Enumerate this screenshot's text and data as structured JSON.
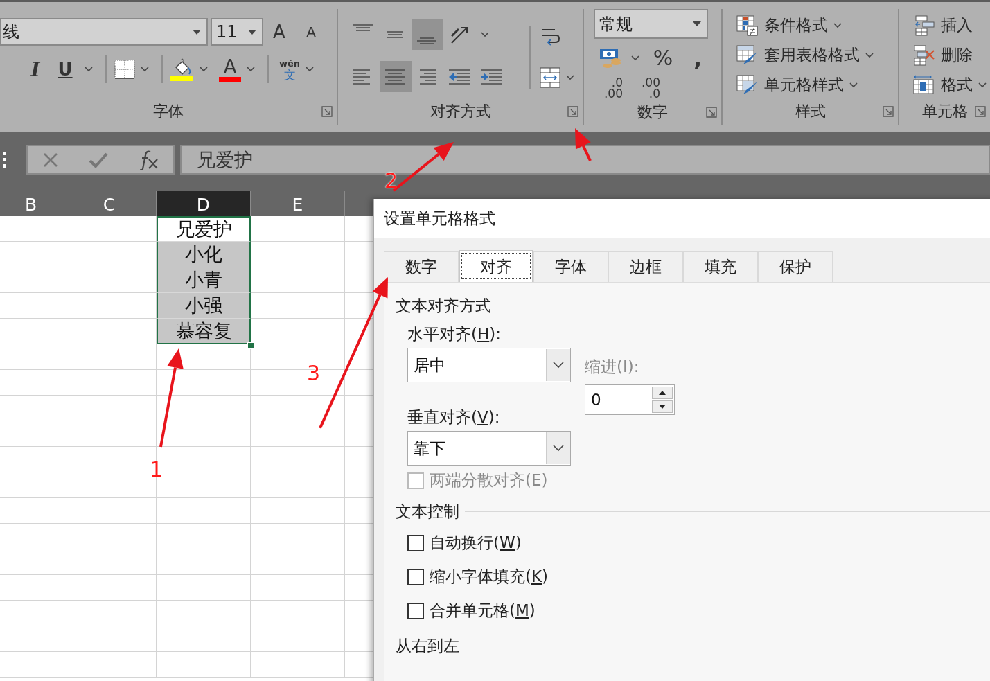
{
  "ribbon": {
    "font": {
      "label": "字体",
      "font_name": "线",
      "font_size": "11",
      "grow_button": "A",
      "shrink_button": "A",
      "italic_button": "I",
      "underline_button": "U",
      "font_color_button": "A",
      "phonetic_button": {
        "top": "wén",
        "bottom": "文"
      }
    },
    "alignment": {
      "label": "对齐方式",
      "buttons": [
        {
          "kind": "top",
          "selected": false
        },
        {
          "kind": "middle",
          "selected": false
        },
        {
          "kind": "bottom",
          "selected": true
        },
        {
          "kind": "orientation",
          "selected": false
        },
        {
          "kind": "left",
          "selected": false
        },
        {
          "kind": "center",
          "selected": true
        },
        {
          "kind": "right",
          "selected": false
        },
        {
          "kind": "outdent",
          "selected": false
        },
        {
          "kind": "indent",
          "selected": false
        }
      ]
    },
    "number": {
      "label": "数字",
      "format": "常规",
      "percent_button": "%",
      "comma_button": ",",
      "increase_decimal": [
        ".0",
        ".00"
      ],
      "decrease_decimal": [
        ".00",
        ".0"
      ]
    },
    "styles": {
      "label": "样式",
      "items": [
        {
          "kind": "conditional",
          "label": "条件格式",
          "has_menu": true
        },
        {
          "kind": "table",
          "label": "套用表格格式",
          "has_menu": true
        },
        {
          "kind": "cell",
          "label": "单元格样式",
          "has_menu": true
        }
      ]
    },
    "cells": {
      "label": "单元格",
      "items": [
        {
          "kind": "insert",
          "label": "插入",
          "has_menu": false
        },
        {
          "kind": "delete",
          "label": "删除",
          "has_menu": false
        },
        {
          "kind": "format",
          "label": "格式",
          "has_menu": true
        }
      ]
    }
  },
  "formula_bar": {
    "value": "兄爱护"
  },
  "sheet": {
    "columns": [
      {
        "label": "B",
        "selected": false
      },
      {
        "label": "C",
        "selected": false
      },
      {
        "label": "D",
        "selected": true
      },
      {
        "label": "E",
        "selected": false
      }
    ],
    "column_d_cells": [
      {
        "text": "兄爱护",
        "active": true
      },
      {
        "text": "小化",
        "active": false
      },
      {
        "text": "小青",
        "active": false
      },
      {
        "text": "小强",
        "active": false
      },
      {
        "text": "慕容复",
        "active": false
      }
    ]
  },
  "dialog": {
    "title": "设置单元格格式",
    "tabs": [
      {
        "label": "数字",
        "selected": false
      },
      {
        "label": "对齐",
        "selected": true
      },
      {
        "label": "字体",
        "selected": false
      },
      {
        "label": "边框",
        "selected": false
      },
      {
        "label": "填充",
        "selected": false
      },
      {
        "label": "保护",
        "selected": false
      }
    ],
    "alignment_section": {
      "title": "文本对齐方式",
      "horizontal": {
        "label": "水平对齐(",
        "access_key": "H",
        "label_end": "):",
        "value": "居中"
      },
      "indent": {
        "label": "缩进(I):",
        "value": "0",
        "disabled": true
      },
      "vertical": {
        "label": "垂直对齐(",
        "access_key": "V",
        "label_end": "):",
        "value": "靠下"
      },
      "justify_distributed": {
        "label": "两端分散对齐(E)",
        "checked": false,
        "disabled": true
      }
    },
    "text_control": {
      "title": "文本控制",
      "options": [
        {
          "label": "自动换行(",
          "access_key": "W",
          "label_end": ")",
          "checked": false
        },
        {
          "label": "缩小字体填充(",
          "access_key": "K",
          "label_end": ")",
          "checked": false
        },
        {
          "label": "合并单元格(",
          "access_key": "M",
          "label_end": ")",
          "checked": false
        }
      ]
    },
    "rtl_section": {
      "title": "从右到左"
    }
  },
  "annotations": [
    {
      "text": "1"
    },
    {
      "text": "2"
    },
    {
      "text": "3"
    }
  ]
}
